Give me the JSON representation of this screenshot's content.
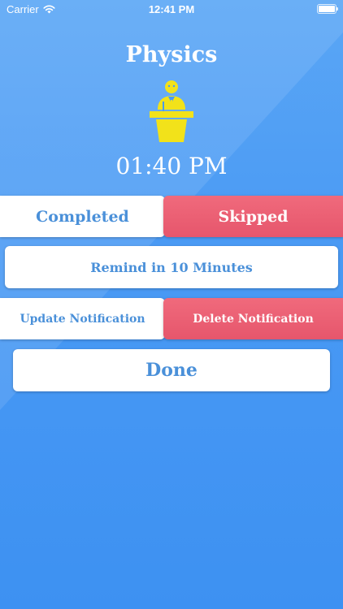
{
  "status_bar": {
    "carrier": "Carrier",
    "time": "12:41 PM"
  },
  "subject": {
    "title": "Physics",
    "icon": "lecturer-podium-icon",
    "time": "01:40 PM"
  },
  "actions": {
    "completed_label": "Completed",
    "skipped_label": "Skipped",
    "remind_label": "Remind in 10 Minutes",
    "update_label": "Update Notification",
    "delete_label": "Delete Notification",
    "done_label": "Done"
  },
  "colors": {
    "background": "#4a9af4",
    "accent_text": "#4a90d9",
    "danger": "#e6566c",
    "icon_yellow": "#f2e21a"
  }
}
